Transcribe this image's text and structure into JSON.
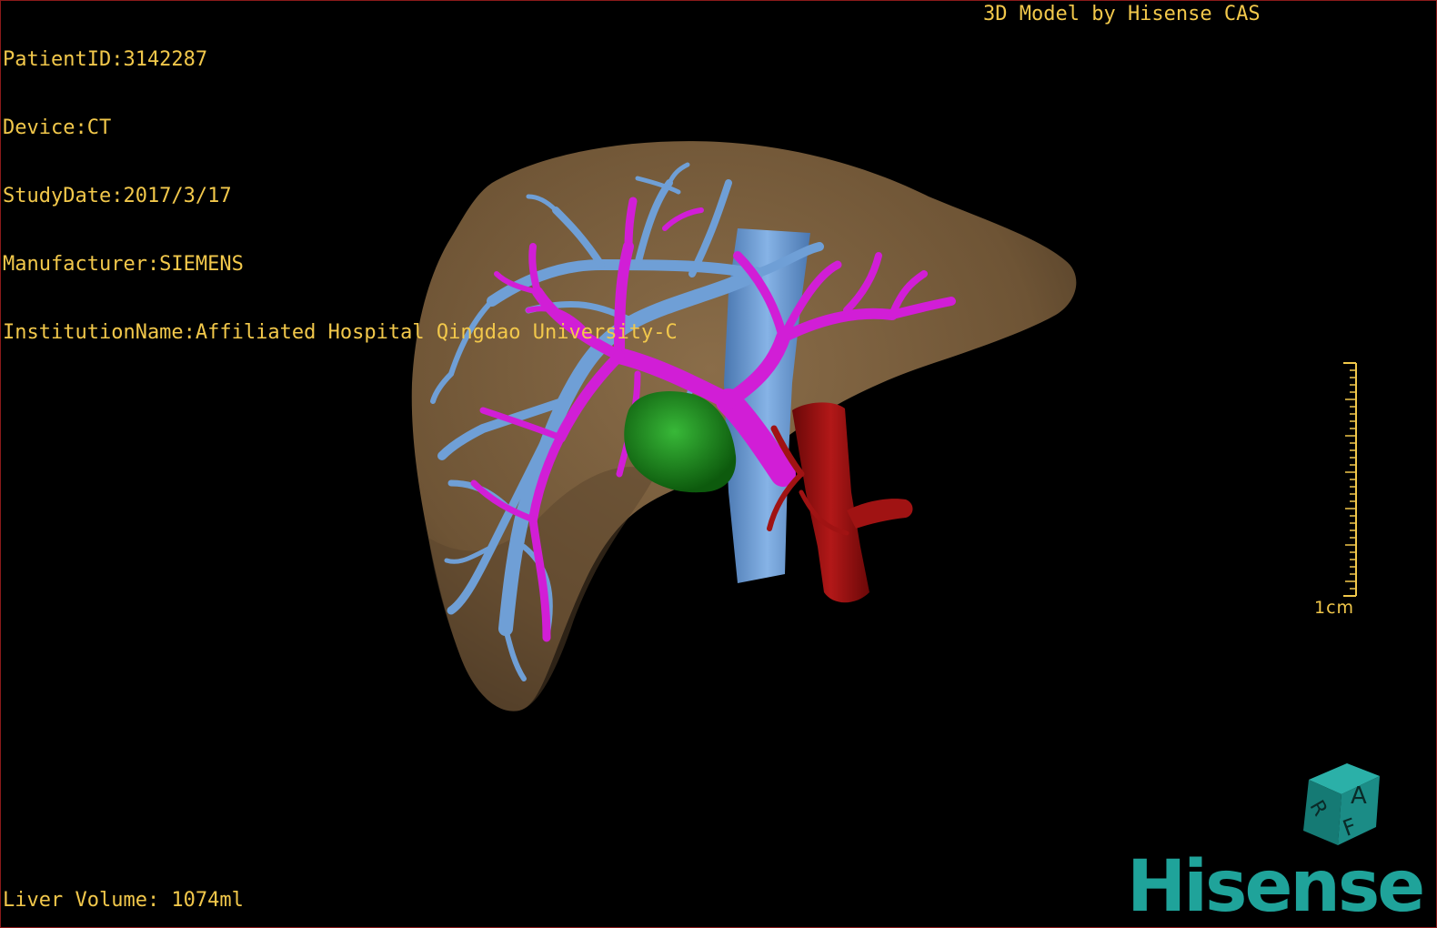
{
  "patient_info": {
    "patient_id": "PatientID:3142287",
    "device": "Device:CT",
    "study_date": "StudyDate:2017/3/17",
    "manufacturer": "Manufacturer:SIEMENS",
    "institution": "InstitutionName:Affiliated Hospital Qingdao University-C"
  },
  "credit": "3D Model by Hisense CAS",
  "liver_volume": "Liver Volume: 1074ml",
  "scale_bar": {
    "label": "1cm"
  },
  "orientation_cube": {
    "face_top": "A",
    "face_side": "F",
    "face_left": "R",
    "color": "#1b8c86"
  },
  "brand_logo": {
    "text": "Hisense",
    "color": "#1fa39a"
  },
  "colors": {
    "overlay_text": "#f2c84b",
    "liver": "#7a6040",
    "hepatic_vein": "#6f9fd6",
    "portal_vein": "#d11ed6",
    "tumor": "#1f8a1f",
    "vena_cava": "#6f9fd6",
    "artery": "#9a0f0f"
  }
}
